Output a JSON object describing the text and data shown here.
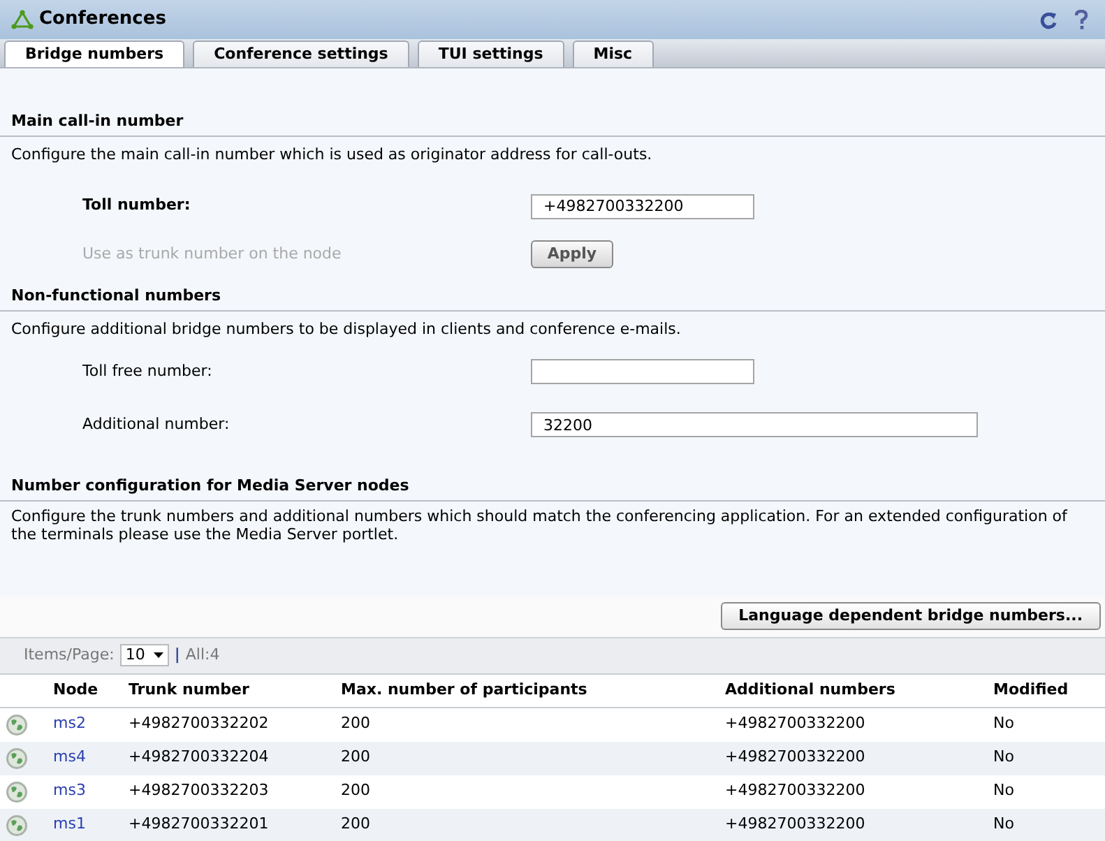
{
  "window": {
    "title": "Conferences"
  },
  "tabs": [
    {
      "label": "Bridge numbers",
      "selected": true
    },
    {
      "label": "Conference settings",
      "selected": false
    },
    {
      "label": "TUI settings",
      "selected": false
    },
    {
      "label": "Misc",
      "selected": false
    }
  ],
  "main_call_in": {
    "heading": "Main call-in number",
    "description": "Configure the main call-in number which is used as originator address for call-outs.",
    "toll_number": {
      "label": "Toll number:",
      "value": "+4982700332200"
    },
    "trunk_option": {
      "label": "Use as trunk number on the node",
      "disabled": true
    },
    "apply_button": "Apply"
  },
  "non_functional": {
    "heading": "Non-functional numbers",
    "description": "Configure additional bridge numbers to be displayed in clients and conference e-mails.",
    "toll_free": {
      "label": "Toll free number:"
    },
    "additional": {
      "label": "Additional number:",
      "value": "32200"
    }
  },
  "media_server": {
    "heading": "Number configuration for Media Server nodes",
    "description": "Configure the trunk numbers and additional numbers which should match the conferencing application. For an extended configuration of the terminals please use the Media Server portlet."
  },
  "language_button": "Language dependent bridge numbers...",
  "pager": {
    "label": "Items/Page:",
    "page_size": "10",
    "separator": "|",
    "total": "All:4"
  },
  "table": {
    "columns": [
      "Node",
      "Trunk number",
      "Max. number of participants",
      "Additional numbers",
      "Modified"
    ],
    "rows": [
      {
        "node": "ms2",
        "trunk": "+4982700332202",
        "max": "200",
        "additional": "+4982700332200",
        "modified": "No"
      },
      {
        "node": "ms4",
        "trunk": "+4982700332204",
        "max": "200",
        "additional": "+4982700332200",
        "modified": "No"
      },
      {
        "node": "ms3",
        "trunk": "+4982700332203",
        "max": "200",
        "additional": "+4982700332200",
        "modified": "No"
      },
      {
        "node": "ms1",
        "trunk": "+4982700332201",
        "max": "200",
        "additional": "+4982700332200",
        "modified": "No"
      }
    ]
  }
}
